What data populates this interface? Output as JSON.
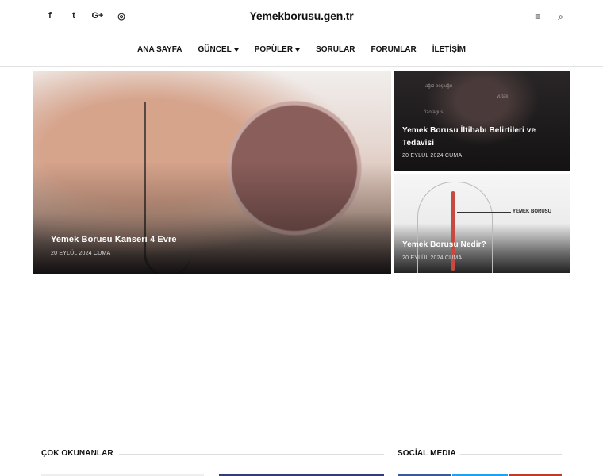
{
  "header": {
    "site_title": "Yemekborusu.gen.tr",
    "social_icons": [
      "facebook-icon",
      "twitter-icon",
      "google-plus-icon",
      "instagram-icon"
    ],
    "social_glyphs": [
      "f",
      "t",
      "G+",
      "◎"
    ],
    "right_glyphs": [
      "≡",
      "⌕"
    ]
  },
  "nav": {
    "items": [
      {
        "label": "ANA SAYFA",
        "has_dropdown": false
      },
      {
        "label": "GÜNCEL",
        "has_dropdown": true
      },
      {
        "label": "POPÜLER",
        "has_dropdown": true
      },
      {
        "label": "SORULAR",
        "has_dropdown": false
      },
      {
        "label": "FORUMLAR",
        "has_dropdown": false
      },
      {
        "label": "İLETİŞİM",
        "has_dropdown": false
      }
    ]
  },
  "featured": {
    "main": {
      "title": "Yemek Borusu Kanseri 4 Evre",
      "date": "20 EYLÜL 2024 CUMA"
    },
    "side": [
      {
        "title": "Yemek Borusu İltihabı Belirtileri ve Tedavisi",
        "date": "20 EYLÜL 2024 CUMA",
        "image_text": [
          "ağız boşluğu",
          "yutak",
          "özofagus"
        ]
      },
      {
        "title": "Yemek Borusu Nedir?",
        "date": "20 EYLÜL 2024 CUMA",
        "image_text": [
          "YEMEK BORUSU"
        ]
      }
    ]
  },
  "sections": {
    "most_read": "ÇOK OKUNANLAR",
    "social_media": "SOCİAL MEDIA"
  },
  "colors": {
    "accent": "#111111",
    "divider": "#e2e2e2"
  }
}
